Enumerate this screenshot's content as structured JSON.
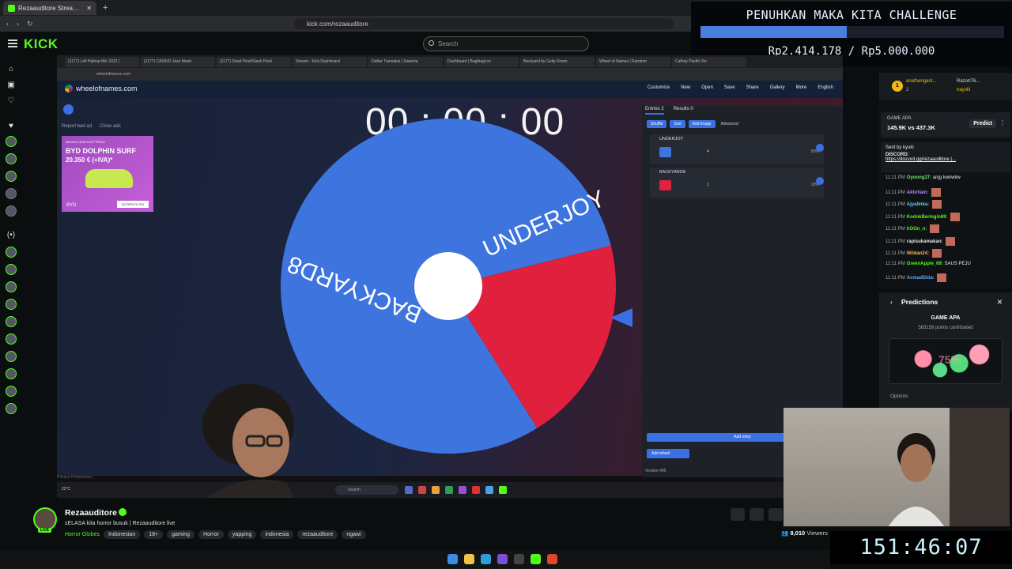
{
  "browser": {
    "tab_title": "Rezaauditore Stream - Watch",
    "url": "kick.com/rezaauditore"
  },
  "kick": {
    "logo": "KICK",
    "search_placeholder": "Search"
  },
  "challenge": {
    "title": "PENUHKAN MAKA KITA CHALLENGE",
    "amount": "Rp2.414.178 / Rp5.000.000",
    "progress_fraction": 0.483
  },
  "stream_screen": {
    "inner_tabs": [
      "(1177) Lofi Hiphop Mix 2022 |",
      "(1177) CASINO Jazz Music",
      "(1177) Dead Pixel/Stack Pixel",
      "Stream - Kick Dashboard",
      "Daftar Transaksi | Saweria",
      "Dashboard | Bagibagi.co",
      "Backyard by Gutty Room",
      "Wheel of Names | Random",
      "Cathay Pacific Re"
    ],
    "inner_url": "wheelofnames.com",
    "won_logo": "wheelofnames.com",
    "won_menu": [
      "Customize",
      "New",
      "Open",
      "Save",
      "Share",
      "Gallery",
      "More",
      "English"
    ],
    "timer": "00 : 00 : 00",
    "ad_links": [
      "Report bad ad",
      "Close ads"
    ],
    "ad": {
      "small": "NUOVO 100% ELETTRICO",
      "title": "BYD DOLPHIN SURF",
      "price": "20.350 € (+IVA)*",
      "brand": "BYD",
      "cta": "SCOPRI DI PIÙ"
    },
    "wheel": {
      "segments": [
        {
          "label": "UNDERJOY",
          "percent": 80,
          "color": "#3d74de"
        },
        {
          "label": "BACKYARD8",
          "percent": 20,
          "color": "#e0203c"
        }
      ]
    },
    "panel": {
      "tabs": [
        "Entries",
        "Results"
      ],
      "tab_counts": [
        "2",
        "0"
      ],
      "toolbar": [
        "Shuffle",
        "Sort",
        "Add image"
      ],
      "advanced": "Advanced",
      "entries": [
        {
          "name": "UNDERJOY",
          "weight": "4",
          "percent": "80%",
          "color": "#3d74de"
        },
        {
          "name": "BACKYARD8",
          "weight": "1",
          "percent": "20%",
          "color": "#e0203c"
        }
      ],
      "add_entry": "Add entry",
      "add_wheel": "Add wheel",
      "version": "Version 405"
    },
    "privacy": "Privacy Preferences",
    "taskbar_search": "Search",
    "weather": "22°C"
  },
  "chat": {
    "top_users": [
      "anathangant...",
      "Razort76...",
      "nayolll"
    ],
    "top_counts": [
      "2"
    ],
    "prediction_card": {
      "title": "GAME APA",
      "values": "145.9K vs 437.3K",
      "button": "Predict"
    },
    "pinned": {
      "sent_by": "Sent by",
      "user": "kyuki",
      "label": "DISCORD:",
      "link": "https://discord.gg/rezaauditore |..."
    },
    "messages": [
      {
        "time": "11:11 PM",
        "user": "Oyoong27:",
        "text": "anjg kwkwkw",
        "color": "#6be86b"
      },
      {
        "time": "11:11 PM",
        "user": "AktoVain:",
        "text": "",
        "color": "#b38cff"
      },
      {
        "time": "11:11 PM",
        "user": "Ajyalinka:",
        "text": "",
        "color": "#5fd3ff"
      },
      {
        "time": "11:11 PM",
        "user": "KodokBeringin69:",
        "text": "",
        "color": "#53fc18"
      },
      {
        "time": "11:11 PM",
        "user": "hOOn_n:",
        "text": "",
        "color": "#53fc18"
      },
      {
        "time": "11:11 PM",
        "user": "rapisukamakan:",
        "text": "",
        "color": "#e6e6e6"
      },
      {
        "time": "11:11 PM",
        "user": "Wildan24:",
        "text": "",
        "color": "#ffb347"
      },
      {
        "time": "11:11 PM",
        "user": "GreenApple_69:",
        "text": "SAUS PEJU",
        "color": "#53fc18"
      },
      {
        "time": "11:11 PM",
        "user": "AcmadDida:",
        "text": "",
        "color": "#5fa8ff"
      }
    ]
  },
  "predictions": {
    "header": "Predictions",
    "question": "GAME APA",
    "points": "583159 points contributed",
    "percent": "75%",
    "options_label": "Options"
  },
  "big_timer": "151:46:07",
  "stream_info": {
    "live": "LIVE",
    "channel": "Rezaauditore",
    "title": "sELASA kita horror busuk | Rezaauditore live",
    "category": "Horror Globes",
    "tags": [
      "Indonesian",
      "18+",
      "gaming",
      "Horror",
      "yapping",
      "indonesia",
      "rezaauditore",
      "ngawi"
    ],
    "viewers_count": "8,010",
    "viewers_label": "Viewers"
  }
}
